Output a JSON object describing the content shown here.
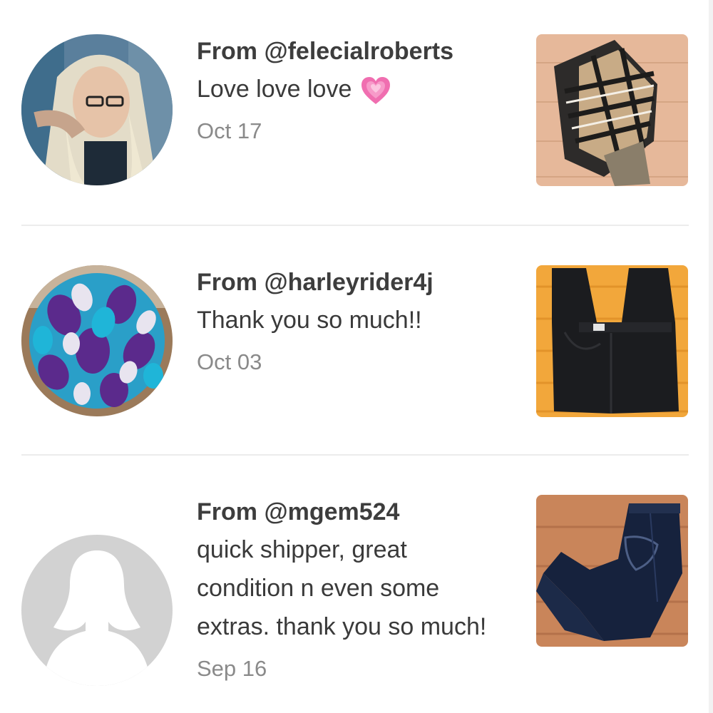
{
  "reviews": [
    {
      "from": "From @felecialroberts",
      "message": "Love love love",
      "emoji": "growing-heart-icon",
      "date": "Oct 17",
      "avatar": "user-photo-avatar",
      "item": "plaid-scarf-photo"
    },
    {
      "from": "From @harleyrider4j",
      "message": "Thank you so much!!",
      "date": "Oct 03",
      "avatar": "flower-bouquet-avatar",
      "item": "black-jeans-photo"
    },
    {
      "from": "From @mgem524",
      "message": "quick shipper, great condition n even some extras. thank you so much!",
      "date": "Sep 16",
      "avatar": "default-avatar-icon",
      "item": "dark-denim-jeans-photo"
    }
  ],
  "colors": {
    "text": "#3a3a3a",
    "date": "#8a8a8a",
    "divider": "#ececec",
    "heart": "#f06eb0"
  }
}
